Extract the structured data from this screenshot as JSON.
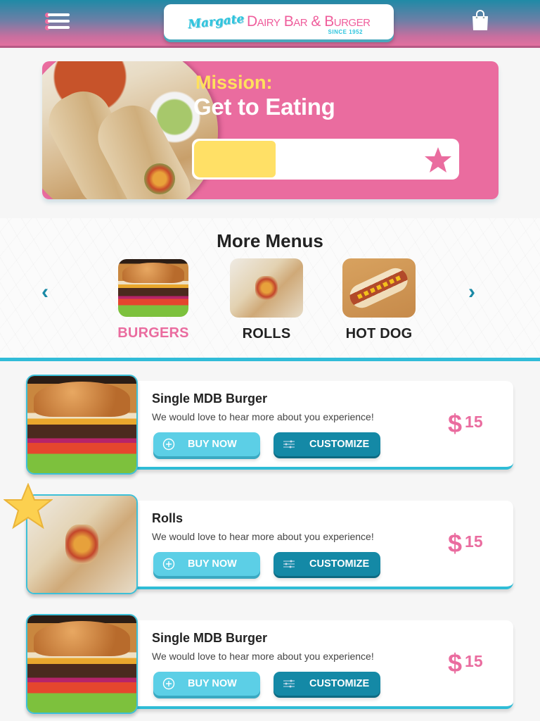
{
  "header": {
    "menu_icon": "hamburger-menu-icon",
    "logo": {
      "script": "Margate",
      "main": "Dairy Bar & Burger",
      "since": "SINCE 1952"
    },
    "cart_icon": "shopping-bag-icon",
    "colors": {
      "top": "#1f8aa6",
      "bottom": "#e2709f"
    }
  },
  "mission": {
    "label": "Mission:",
    "title": "Get to Eating",
    "progress_percent": 31,
    "goal_icon": "star-icon",
    "colors": {
      "background": "#ea6c9f",
      "label": "#ffe05c",
      "fill": "#ffe066"
    }
  },
  "more_menus": {
    "title": "More Menus",
    "prev_icon": "chevron-left-icon",
    "next_icon": "chevron-right-icon",
    "categories": [
      {
        "label": "BURGERS",
        "active": true
      },
      {
        "label": "ROLLS",
        "active": false
      },
      {
        "label": "HOT DOG",
        "active": false
      }
    ]
  },
  "items": [
    {
      "name": "Single MDB Burger",
      "description": "We would love to hear more about you  experience!",
      "buy_label": "BUY NOW",
      "customize_label": "CUSTOMIZE",
      "currency": "$",
      "price": "15",
      "favorite": false
    },
    {
      "name": "Rolls",
      "description": "We would love to hear more about you  experience!",
      "buy_label": "BUY NOW",
      "customize_label": "CUSTOMIZE",
      "currency": "$",
      "price": "15",
      "favorite": true
    },
    {
      "name": "Single MDB Burger",
      "description": "We would love to hear more about you  experience!",
      "buy_label": "BUY NOW",
      "customize_label": "CUSTOMIZE",
      "currency": "$",
      "price": "15",
      "favorite": false
    }
  ],
  "colors": {
    "accent_pink": "#ea6c9f",
    "accent_cyan": "#5ccfe6",
    "accent_teal": "#1489a6"
  }
}
